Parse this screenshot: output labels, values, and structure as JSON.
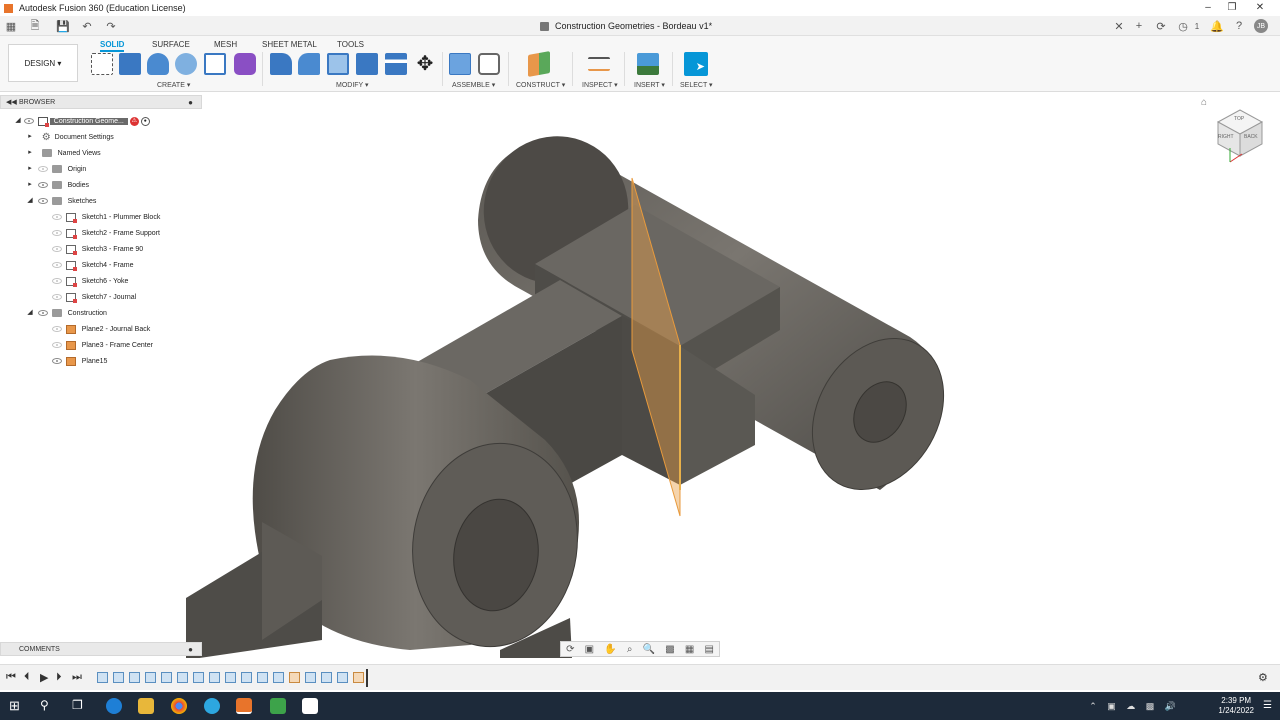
{
  "window": {
    "title": "Autodesk Fusion 360 (Education License)",
    "doc_tab": "Construction Geometries - Bordeau v1*",
    "notifications_count": "1"
  },
  "ribbon": {
    "design_button": "DESIGN",
    "tabs": [
      "SOLID",
      "SURFACE",
      "MESH",
      "SHEET METAL",
      "TOOLS"
    ],
    "groups": {
      "create": "CREATE",
      "modify": "MODIFY",
      "assemble": "ASSEMBLE",
      "construct": "CONSTRUCT",
      "inspect": "INSPECT",
      "insert": "INSERT",
      "select": "SELECT"
    }
  },
  "browser": {
    "header": "BROWSER",
    "root": "Construction Geome...",
    "document_settings": "Document Settings",
    "named_views": "Named Views",
    "origin": "Origin",
    "bodies": "Bodies",
    "sketches": "Sketches",
    "sketch_items": [
      "Sketch1 - Plummer Block",
      "Sketch2 - Frame Support",
      "Sketch3 - Frame 90",
      "Sketch4 - Frame",
      "Sketch6 - Yoke",
      "Sketch7 - Journal"
    ],
    "construction": "Construction",
    "construction_items": [
      "Plane2 - Journal Back",
      "Plane3 - Frame Center",
      "Plane15"
    ]
  },
  "comments": {
    "label": "COMMENTS"
  },
  "viewcube": {
    "labels": [
      "TOP",
      "RIGHT",
      "BACK"
    ]
  },
  "taskbar": {
    "time": "2:39 PM",
    "date": "1/24/2022"
  },
  "colors": {
    "accent": "#0696d7",
    "body": "#5d5a55",
    "plane": "#e8974a",
    "taskbar": "#1d2a3a"
  }
}
